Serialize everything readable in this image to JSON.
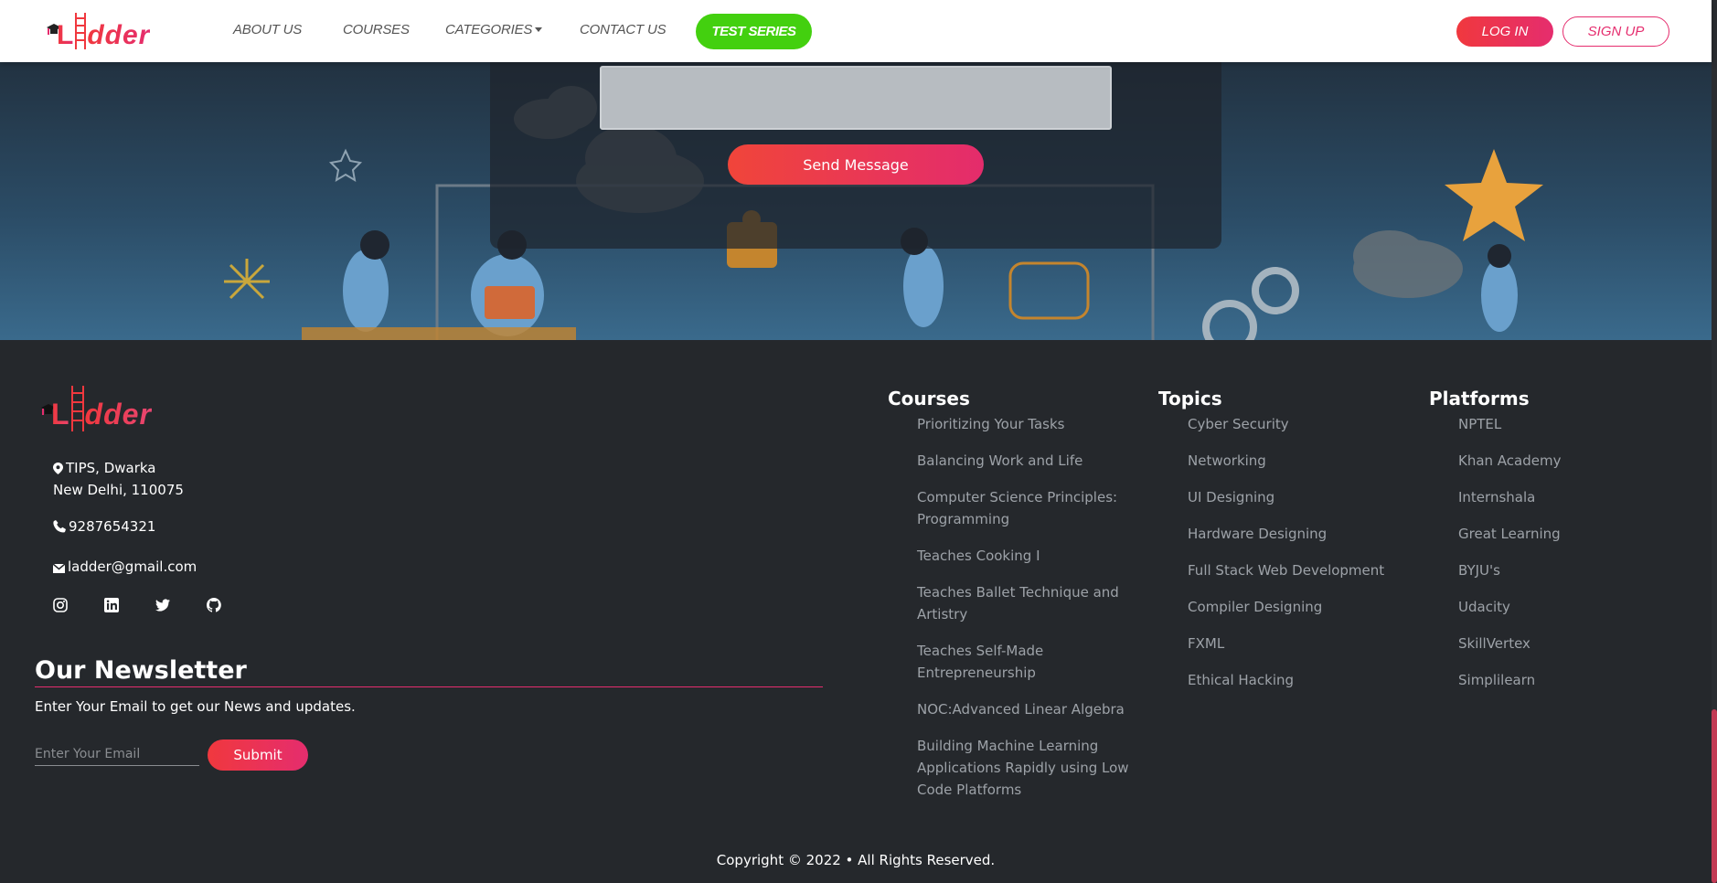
{
  "brand": {
    "logo_text": "Ladder",
    "logo_cap": "L",
    "logo_rest": "dder",
    "accent": "#e52d6e",
    "accent2": "#f0383e"
  },
  "nav": {
    "about": "ABOUT US",
    "courses": "COURSES",
    "categories": "CATEGORIES",
    "contact": "CONTACT US",
    "test_series": "TEST SERIES",
    "login": "LOG IN",
    "signup": "SIGN UP"
  },
  "contact": {
    "send_label": "Send Message"
  },
  "footer": {
    "address_line1": "TIPS, Dwarka",
    "address_line2": "New Delhi, 110075",
    "phone": "9287654321",
    "email": "ladder@gmail.com",
    "social": [
      "instagram-icon",
      "linkedin-icon",
      "twitter-icon",
      "github-icon"
    ],
    "newsletter": {
      "title": "Our Newsletter",
      "desc": "Enter Your Email to get our News and updates.",
      "placeholder": "Enter Your Email",
      "submit": "Submit"
    },
    "courses": {
      "title": "Courses",
      "items": [
        "Prioritizing Your Tasks",
        "Balancing Work and Life",
        "Computer Science Principles: Programming",
        "Teaches Cooking I",
        "Teaches Ballet Technique and Artistry",
        "Teaches Self-Made Entrepreneurship",
        "NOC:Advanced Linear Algebra",
        "Building Machine Learning Applications Rapidly using Low Code Platforms"
      ]
    },
    "topics": {
      "title": "Topics",
      "items": [
        "Cyber Security",
        "Networking",
        "UI Designing",
        "Hardware Designing",
        "Full Stack Web Development",
        "Compiler Designing",
        "FXML",
        "Ethical Hacking"
      ]
    },
    "platforms": {
      "title": "Platforms",
      "items": [
        "NPTEL",
        "Khan Academy",
        "Internshala",
        "Great Learning",
        "BYJU's",
        "Udacity",
        "SkillVertex",
        "Simplilearn"
      ]
    },
    "copyright": "Copyright © 2022 • All Rights Reserved."
  }
}
